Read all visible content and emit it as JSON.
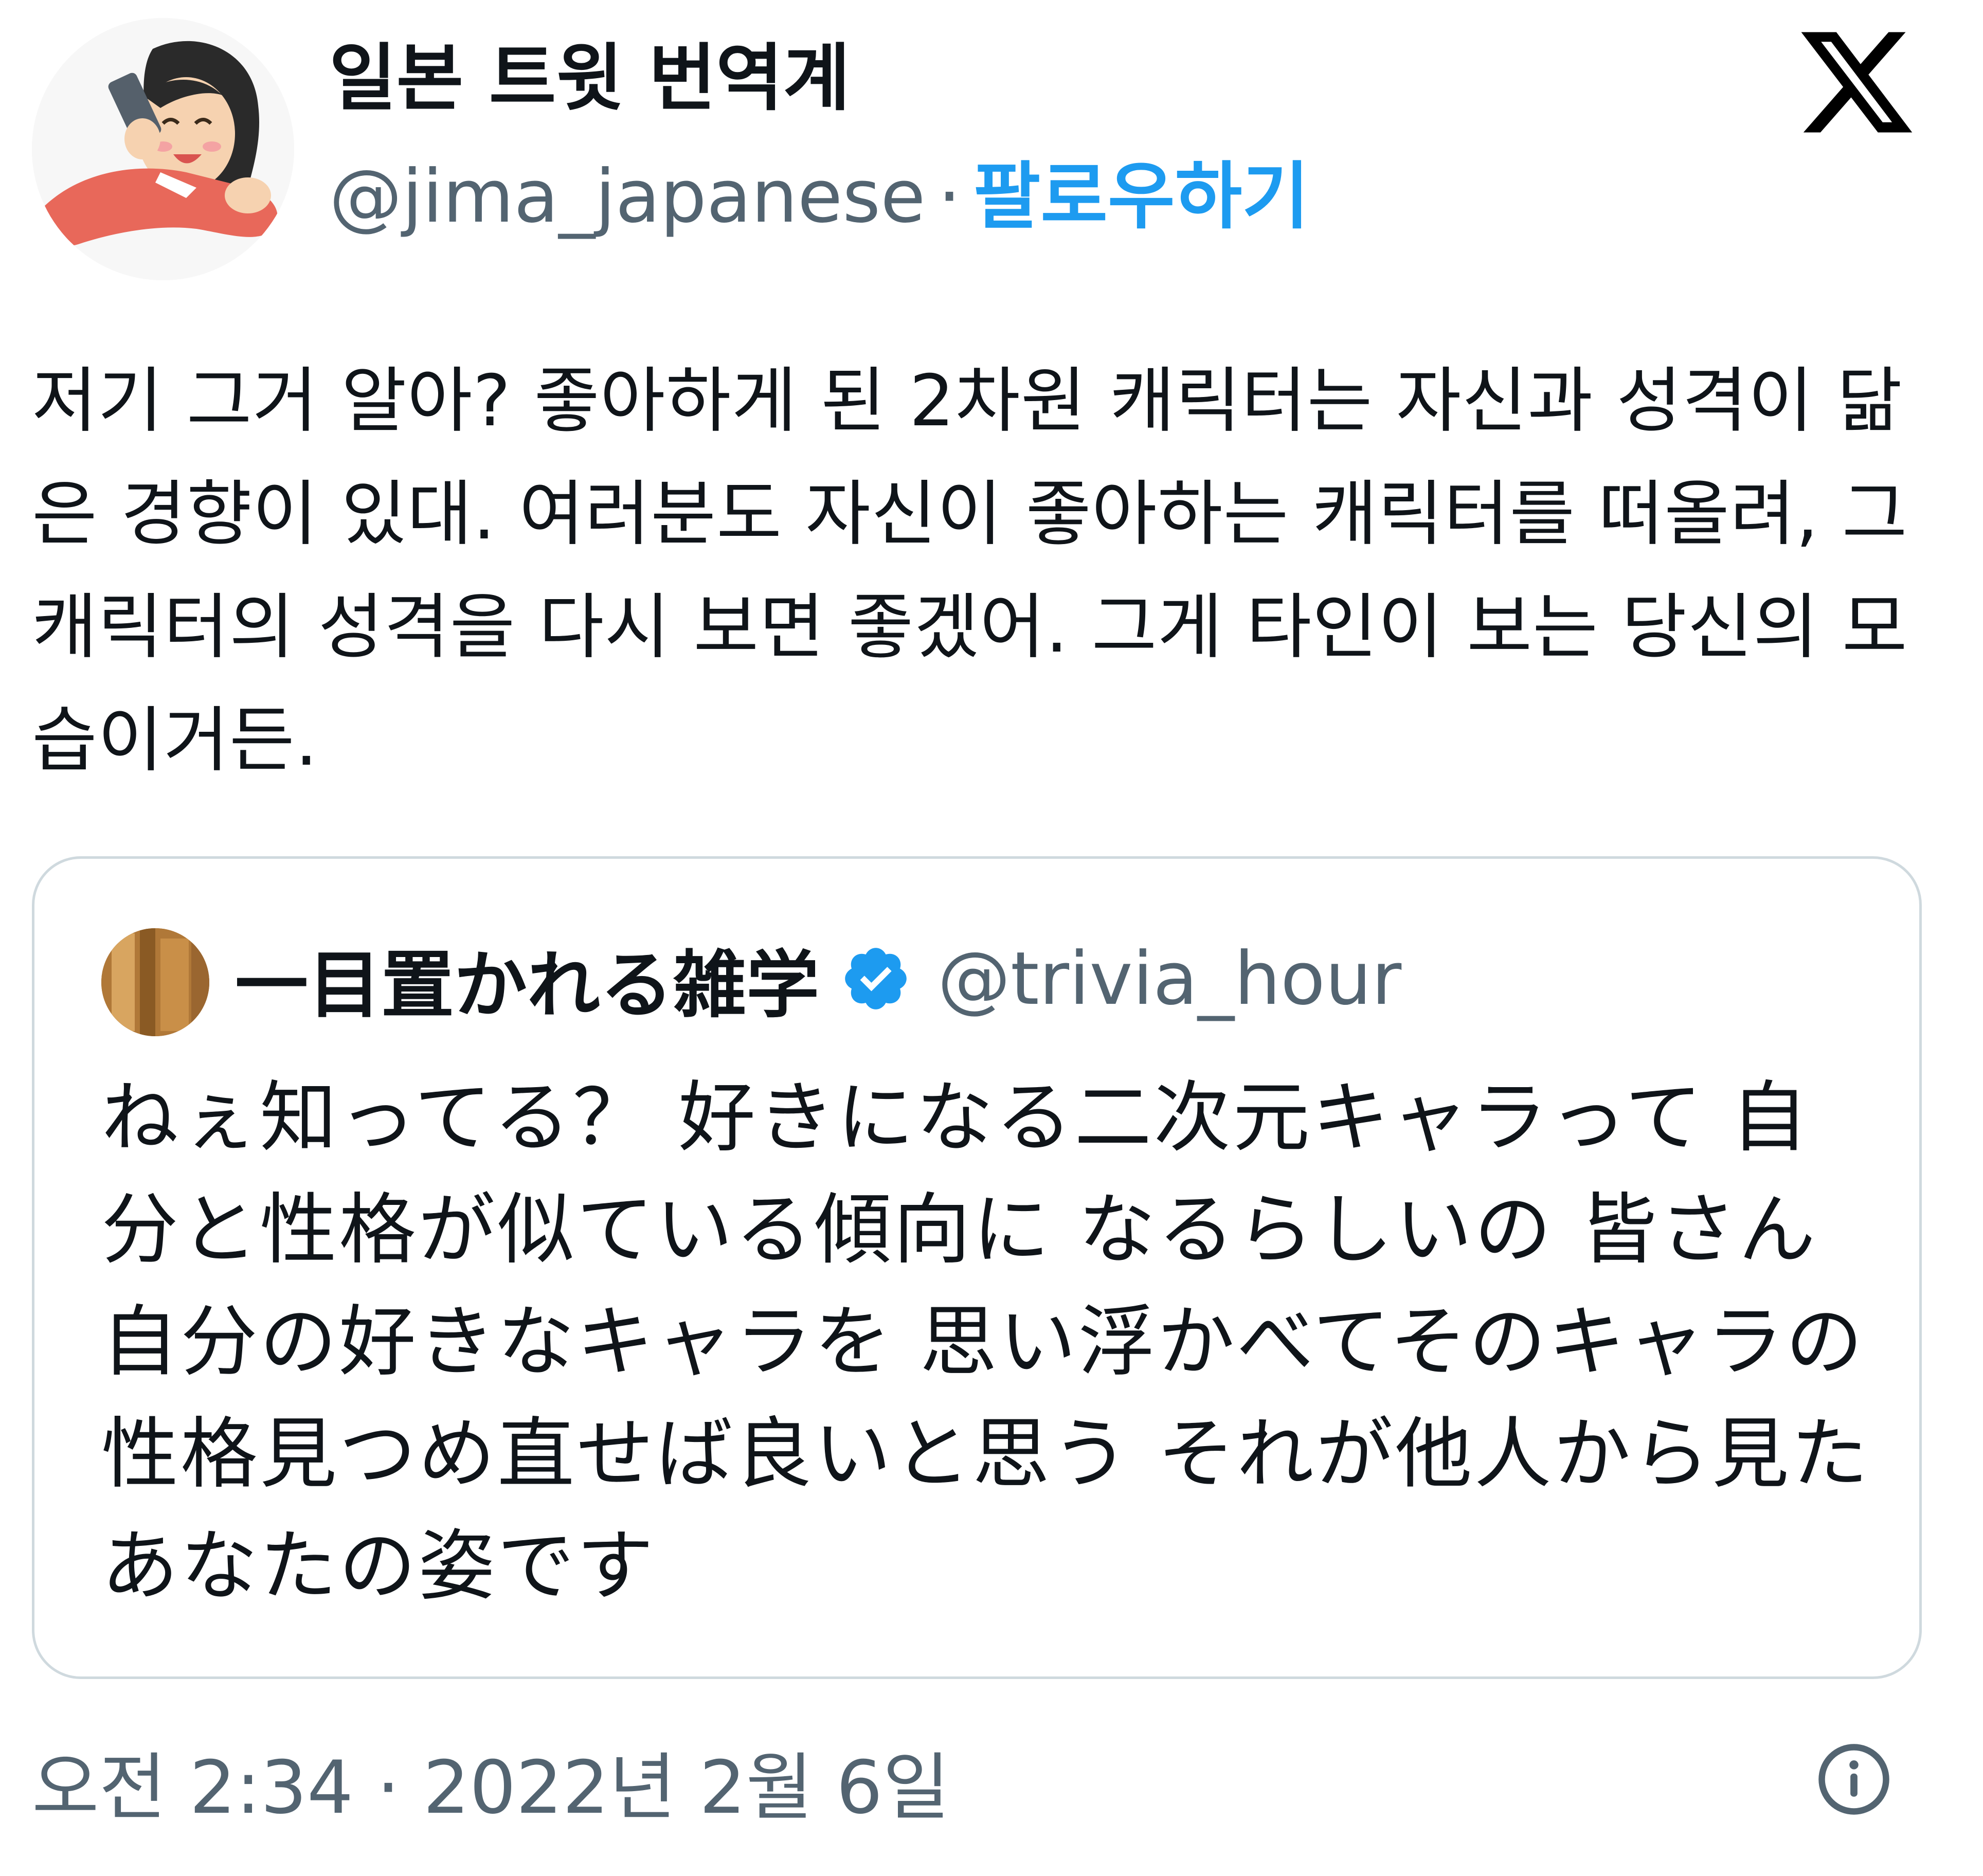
{
  "author": {
    "display_name": "일본 트윗 번역계",
    "handle": "@jima_japanese",
    "separator": "·",
    "follow_label": "팔로우하기",
    "avatar_icon": "woman-on-phone-illustration"
  },
  "brand": {
    "logo_icon": "x-logo-icon"
  },
  "tweet": {
    "text": "저기 그거 알아? 좋아하게 된 2차원 캐릭터는 자신과 성격이 닮은 경향이 있대. 여러분도 자신이 좋아하는 캐릭터를 떠올려, 그 캐릭터의 성격을 다시 보면 좋겠어. 그게 타인이 보는 당신의 모습이거든.",
    "timestamp": "오전 2:34 · 2022년 2월 6일"
  },
  "quoted_tweet": {
    "display_name": "一目置かれる雑学",
    "handle": "@trivia_hour",
    "verified": true,
    "text": "ねぇ知ってる？ 好きになる二次元キャラって 自分と性格が似ている傾向に なるらしいの 皆さん自分の好きなキャラを 思い浮かべてそのキャラの 性格見つめ直せば良いと思う それが他人から見たあなたの姿です"
  },
  "colors": {
    "link_blue": "#1d9bf0",
    "secondary_text": "#536471",
    "border": "#cfd9de",
    "text": "#0f1419"
  },
  "icons": {
    "verified": "verified-badge-icon",
    "info": "info-icon"
  }
}
